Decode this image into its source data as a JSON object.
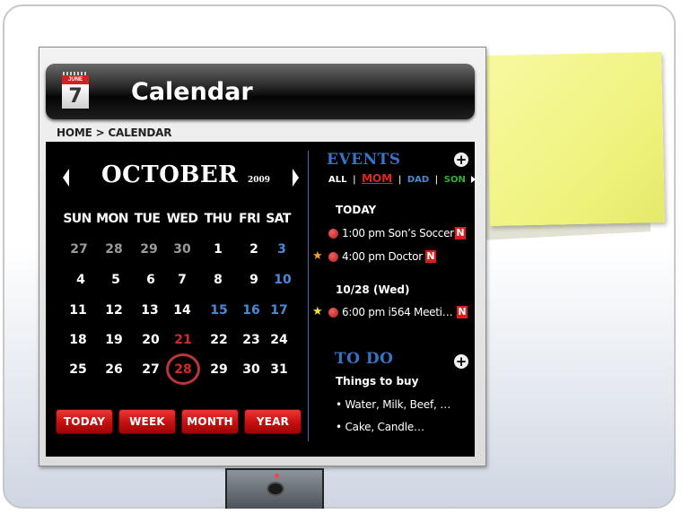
{
  "app": {
    "title": "Calendar",
    "icon": {
      "name": "calendar-icon",
      "month": "JUNE",
      "day": "7"
    }
  },
  "breadcrumb": {
    "home": "HOME",
    "separator": ">",
    "current": "CALENDAR"
  },
  "calendar": {
    "month": "OCTOBER",
    "year": "2009",
    "weekdays": [
      "SUN",
      "MON",
      "TUE",
      "WED",
      "THU",
      "FRI",
      "SAT"
    ],
    "weeks": [
      [
        "27",
        "28",
        "29",
        "30",
        "1",
        "2",
        "3"
      ],
      [
        "4",
        "5",
        "6",
        "7",
        "8",
        "9",
        "10"
      ],
      [
        "11",
        "12",
        "13",
        "14",
        "15",
        "16",
        "17"
      ],
      [
        "18",
        "19",
        "20",
        "21",
        "22",
        "23",
        "24"
      ],
      [
        "25",
        "26",
        "27",
        "28",
        "29",
        "30",
        "31"
      ]
    ],
    "selected_date": "28",
    "views": [
      "TODAY",
      "WEEK",
      "MONTH",
      "YEAR"
    ]
  },
  "events": {
    "title": "EVENTS",
    "add_icon": "plus-icon",
    "filters": {
      "all": "ALL",
      "mom": "MOM",
      "dad": "DAD",
      "son": "SON",
      "separator": "|"
    },
    "today_label": "TODAY",
    "today_items": [
      {
        "text": "1:00 pm Son’s Soccer",
        "badge": "N",
        "star": ""
      },
      {
        "text": "4:00 pm Doctor",
        "badge": "N",
        "star": "★"
      }
    ],
    "later_label": "10/28 (Wed)",
    "later_items": [
      {
        "text": "6:00 pm i564 Meeti…",
        "badge": "N",
        "star": "★"
      }
    ]
  },
  "todo": {
    "title": "TO DO",
    "subtitle": "Things to buy",
    "items": [
      "• Water, Milk, Beef, …",
      "• Cake, Candle…"
    ]
  },
  "colors": {
    "accent_blue": "#3a72c4",
    "alert_red": "#e11b1b",
    "sticky_yellow": "#eef27a",
    "son_green": "#35b035"
  }
}
